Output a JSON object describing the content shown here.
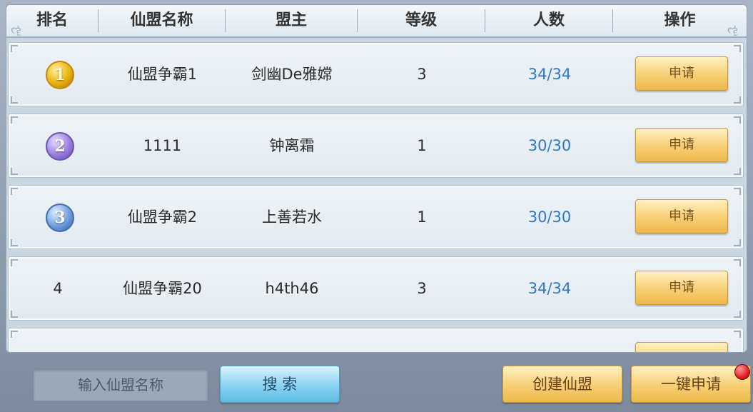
{
  "header": {
    "columns": [
      "排名",
      "仙盟名称",
      "盟主",
      "等级",
      "人数",
      "操作"
    ]
  },
  "rows": [
    {
      "rank": "1",
      "rank_icon": "gold-medal-1",
      "name": "仙盟争霸1",
      "leader": "剑幽De雅嫦",
      "level": "3",
      "members": "34/34",
      "action": "申请"
    },
    {
      "rank": "2",
      "rank_icon": "silver-medal-2",
      "name": "1111",
      "leader": "钟离霜",
      "level": "1",
      "members": "30/30",
      "action": "申请"
    },
    {
      "rank": "3",
      "rank_icon": "bronze-medal-3",
      "name": "仙盟争霸2",
      "leader": "上善若水",
      "level": "1",
      "members": "30/30",
      "action": "申请"
    },
    {
      "rank": "4",
      "name": "仙盟争霸20",
      "leader": "h4th46",
      "level": "3",
      "members": "34/34",
      "action": "申请"
    }
  ],
  "search": {
    "placeholder": "输入仙盟名称",
    "button_label": "搜 索"
  },
  "actions": {
    "create_label": "创建仙盟",
    "one_key_apply_label": "一键申请"
  },
  "colors": {
    "member_count": "#2f78c8",
    "apply_button": "#f7d27a",
    "search_button": "#8fd6f2",
    "notification_dot": "#e02020"
  }
}
